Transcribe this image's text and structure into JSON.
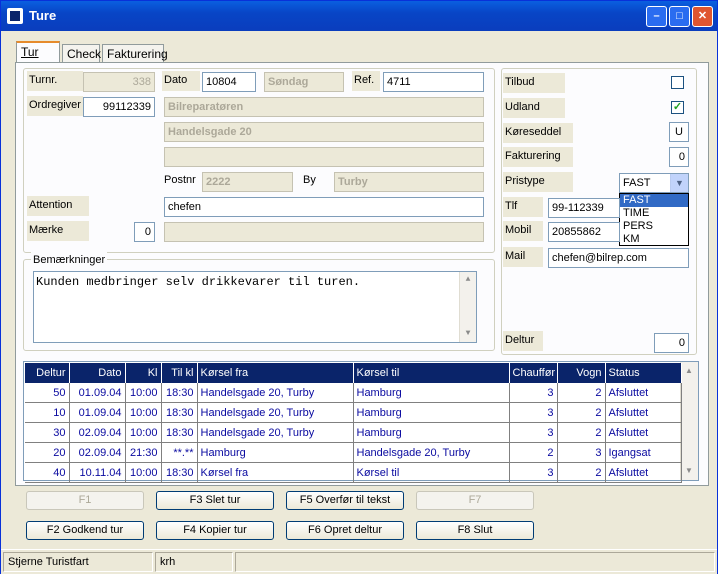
{
  "window": {
    "title": "Ture"
  },
  "tabs": [
    {
      "label": "Tur"
    },
    {
      "label": "Check"
    },
    {
      "label": "Fakturering"
    }
  ],
  "form": {
    "turnr_label": "Turnr.",
    "turnr_value": "338",
    "dato_label": "Dato",
    "dato_value": "10804",
    "dag_value": "Søndag",
    "ref_label": "Ref.",
    "ref_value": "4711",
    "ordregiver_label": "Ordregiver",
    "ordregiver_value": "99112339",
    "name_value": "Bilreparatøren",
    "address_value": "Handelsgade 20",
    "address2_value": "",
    "postnr_label": "Postnr",
    "postnr_value": "2222",
    "by_label": "By",
    "by_value": "Turby",
    "attention_label": "Attention",
    "attention_value": "chefen",
    "maerke_label": "Mærke",
    "maerke_value": "0",
    "maerke_text": "",
    "bemaerkninger_label": "Bemærkninger",
    "bemaerkninger_value": "Kunden medbringer selv drikkevarer til turen."
  },
  "side": {
    "tilbud_label": "Tilbud",
    "udland_label": "Udland",
    "koereseddel_label": "Køreseddel",
    "koereseddel_value": "U",
    "fakturering_label": "Fakturering",
    "fakturering_value": "0",
    "pristype_label": "Pristype",
    "pristype_value": "FAST",
    "pristype_options": [
      "FAST",
      "TIME",
      "PERS",
      "KM"
    ],
    "tlf_label": "Tlf",
    "tlf_value": "99-112339",
    "mobil_label": "Mobil",
    "mobil_value": "20855862",
    "mail_label": "Mail",
    "mail_value": "chefen@bilrep.com",
    "deltur_label": "Deltur",
    "deltur_value": "0"
  },
  "grid": {
    "headers": [
      "Deltur",
      "Dato",
      "Kl",
      "Til kl",
      "Kørsel fra",
      "Kørsel til",
      "Chauffør",
      "Vogn",
      "Status"
    ],
    "rows": [
      [
        "50",
        "01.09.04",
        "10:00",
        "18:30",
        "Handelsgade 20, Turby",
        "Hamburg",
        "3",
        "2",
        "Afsluttet"
      ],
      [
        "10",
        "01.09.04",
        "10:00",
        "18:30",
        "Handelsgade 20, Turby",
        "Hamburg",
        "3",
        "2",
        "Afsluttet"
      ],
      [
        "30",
        "02.09.04",
        "10:00",
        "18:30",
        "Handelsgade 20, Turby",
        "Hamburg",
        "3",
        "2",
        "Afsluttet"
      ],
      [
        "20",
        "02.09.04",
        "21:30",
        "**.**",
        "Hamburg",
        "Handelsgade 20, Turby",
        "2",
        "3",
        "Igangsat"
      ],
      [
        "40",
        "10.11.04",
        "10:00",
        "18:30",
        "Kørsel fra",
        "Kørsel til",
        "3",
        "2",
        "Afsluttet"
      ]
    ]
  },
  "buttons": {
    "f1": "F1",
    "f3": "F3 Slet tur",
    "f5": "F5 Overfør til tekst",
    "f7": "F7",
    "f2": "F2 Godkend tur",
    "f4": "F4 Kopier tur",
    "f6": "F6 Opret deltur",
    "f8": "F8 Slut"
  },
  "status": {
    "company": "Stjerne Turistfart",
    "user": "krh"
  }
}
